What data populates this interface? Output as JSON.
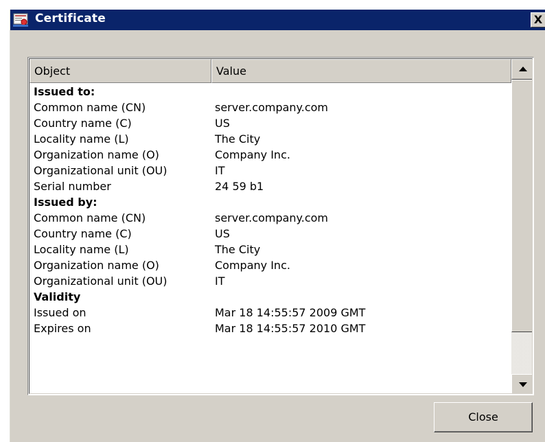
{
  "window": {
    "title": "Certificate",
    "close_glyph": "X",
    "icon": "certificate-icon"
  },
  "table": {
    "columns": [
      "Object",
      "Value"
    ],
    "rows": [
      {
        "object": "Issued to:",
        "value": "",
        "section": true
      },
      {
        "object": "Common name (CN)",
        "value": "server.company.com"
      },
      {
        "object": "Country name (C)",
        "value": "US"
      },
      {
        "object": "Locality name (L)",
        "value": "The City"
      },
      {
        "object": "Organization name (O)",
        "value": "Company Inc."
      },
      {
        "object": "Organizational unit (OU)",
        "value": "IT"
      },
      {
        "object": "Serial number",
        "value": "24 59 b1"
      },
      {
        "object": "Issued by:",
        "value": "",
        "section": true
      },
      {
        "object": "Common name (CN)",
        "value": "server.company.com"
      },
      {
        "object": "Country name (C)",
        "value": "US"
      },
      {
        "object": "Locality name (L)",
        "value": "The City"
      },
      {
        "object": "Organization name (O)",
        "value": "Company Inc."
      },
      {
        "object": "Organizational unit (OU)",
        "value": "IT"
      },
      {
        "object": "Validity",
        "value": "",
        "section": true
      },
      {
        "object": "Issued on",
        "value": "Mar 18 14:55:57 2009 GMT"
      },
      {
        "object": "Expires on",
        "value": "Mar 18 14:55:57 2010 GMT"
      }
    ]
  },
  "footer": {
    "close_label": "Close"
  },
  "colors": {
    "titlebar": "#0a246a",
    "face": "#d4d0c8"
  }
}
